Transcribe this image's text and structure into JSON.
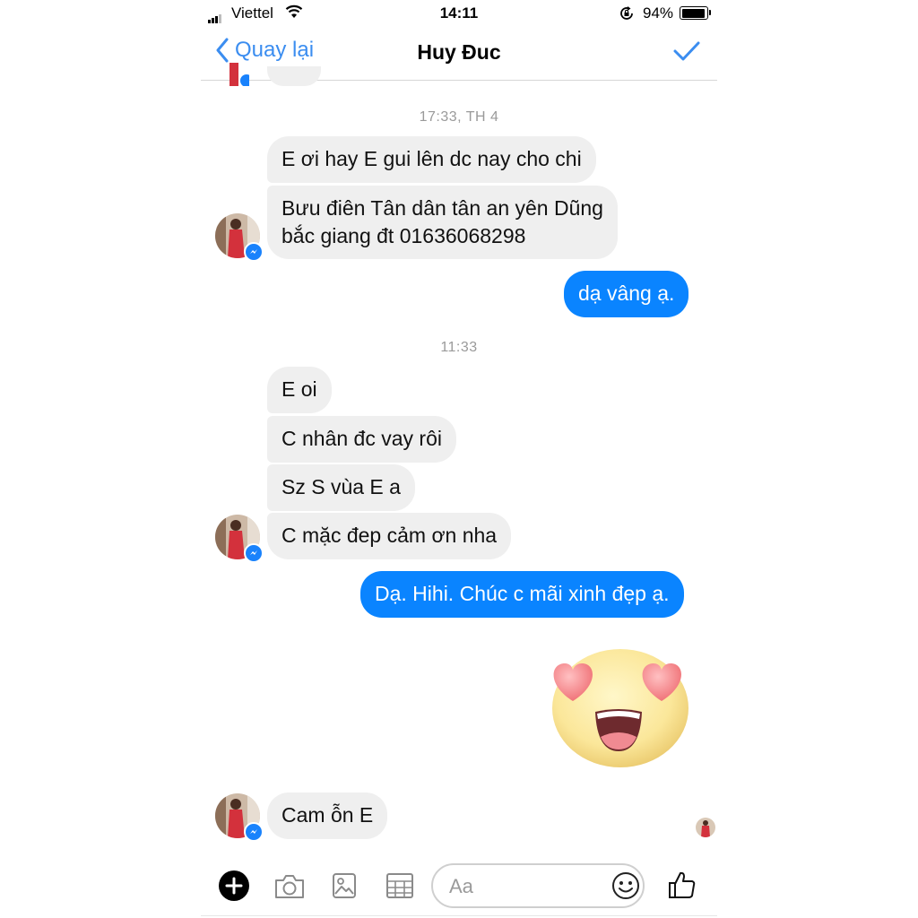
{
  "status_bar": {
    "carrier": "Viettel",
    "time": "14:11",
    "battery_percent": "94%",
    "battery_level": 0.94
  },
  "nav": {
    "back_label": "Quay lại",
    "title": "Huy Đuc"
  },
  "conversation": {
    "timestamps": [
      "17:33, TH 4",
      "11:33"
    ],
    "messages": [
      {
        "from": "them",
        "text": "E ơi hay E gui lên dc nay cho chi"
      },
      {
        "from": "them",
        "text": "Bưu điên Tân dân tân an yên Dũng\nbắc giang  đt 01636068298"
      },
      {
        "from": "me",
        "text": "dạ vâng ạ."
      },
      {
        "from": "them",
        "text": "E oi"
      },
      {
        "from": "them",
        "text": "C nhân đc vay rôi"
      },
      {
        "from": "them",
        "text": "Sz S vùa E a"
      },
      {
        "from": "them",
        "text": "C mặc đep cảm ơn nha"
      },
      {
        "from": "me",
        "text": "Dạ. Hihi. Chúc c mãi xinh đẹp ạ."
      },
      {
        "from": "me",
        "emoji": "heart-eyes-emoji"
      },
      {
        "from": "them",
        "text": "Cam ỗn E"
      }
    ]
  },
  "composer": {
    "placeholder": "Aa",
    "icons": [
      "plus-icon",
      "camera-icon",
      "photo-icon",
      "sticker-icon",
      "emoji-icon",
      "thumbs-up-icon"
    ]
  },
  "colors": {
    "accent": "#0a84ff",
    "incoming_bubble": "#efefef",
    "nav_link": "#3b8df0"
  }
}
